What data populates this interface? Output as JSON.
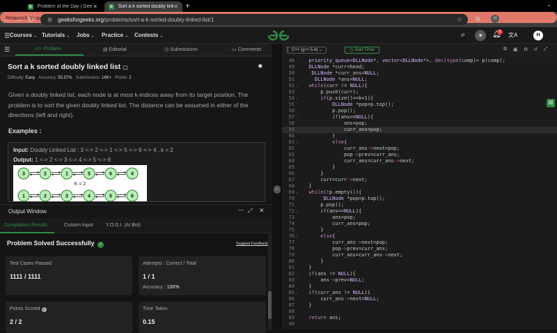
{
  "browser": {
    "tabs": [
      {
        "title": "Problem of the Day | GeeksforG",
        "active": false
      },
      {
        "title": "Sort a k sorted doubly linked",
        "active": true
      }
    ],
    "url_domain": "geeksforgeeks.org",
    "url_path": "/problems/sort-a-k-sorted-doubly-linked-list/1",
    "profile_initial": "H",
    "relaunch_label": "Relaunch to update"
  },
  "site": {
    "menu": [
      "Courses",
      "Tutorials",
      "Jobs",
      "Practice",
      "Contests"
    ],
    "notif_count": "5",
    "avatar": "H"
  },
  "problem_tabs": [
    "Problem",
    "Editorial",
    "Submissions",
    "Comments"
  ],
  "editor_bar": {
    "language": "C++ (g++ 5.4)",
    "timer": "Start Timer"
  },
  "problem": {
    "title": "Sort a k sorted doubly linked list",
    "difficulty_label": "Difficulty:",
    "difficulty": "Easy",
    "accuracy_label": "Accuracy:",
    "accuracy": "55.57%",
    "submissions_label": "Submissions:",
    "submissions": "16K+",
    "points_label": "Points:",
    "points": "2",
    "description": "Given a doubly linked list, each node is at most k-indices away from its target position. The problem is to sort the given doubly linked list. The distance can be assumed in either of the directions (left and right).",
    "examples_heading": "Examples :",
    "input_label": "Input:",
    "input_text": "Doubly Linked List : 3 <-> 2 <-> 1 <-> 5 <-> 6 <-> 4 , k = 2",
    "output_label": "Output:",
    "output_text": "1 <-> 2 <-> 3 <-> 4 <-> 5 <-> 6",
    "diagram_row1": [
      "3",
      "2",
      "1",
      "5",
      "6",
      "4"
    ],
    "diagram_k": "K = 2",
    "diagram_row2": [
      "1",
      "2",
      "3",
      "4",
      "5",
      "6"
    ]
  },
  "output": {
    "window_title": "Output Window",
    "tabs": [
      "Compilation Results",
      "Custom Input",
      "Y.O.G.I. (AI Bot)"
    ],
    "status": "Problem Solved Successfully",
    "suggest": "Suggest Feedback",
    "test_cases_label": "Test Cases Passed",
    "test_cases": "1111 / 1111",
    "attempts_label": "Attempts : Correct / Total",
    "attempts": "1 / 1",
    "accuracy_label": "Accuracy :",
    "accuracy": "100%",
    "points_label": "Points Scored",
    "points": "2 / 2",
    "time_label": "Time Taken",
    "time": "0.15"
  },
  "code": [
    {
      "n": "48",
      "t": "  priority_queue<DLLNode*, vector<DLLNode*>, decltype(comp)> p(comp);"
    },
    {
      "n": "49",
      "t": "  DLLNode *curr=head;"
    },
    {
      "n": "50",
      "t": "   DLLNode *curr_ans=NULL;"
    },
    {
      "n": "51",
      "t": "    DLLNode *ans=NULL;"
    },
    {
      "n": "52",
      "t": "  while(curr != NULL){",
      "f": true
    },
    {
      "n": "53",
      "t": "      p.push(curr);"
    },
    {
      "n": "54",
      "t": "      if(p.size()==k+1){",
      "f": true
    },
    {
      "n": "55",
      "t": "          DLLNode *pop=p.top();"
    },
    {
      "n": "56",
      "t": "          p.pop();"
    },
    {
      "n": "57",
      "t": "          if(ans==NULL){",
      "f": true
    },
    {
      "n": "58",
      "t": "              ans=pop;"
    },
    {
      "n": "59",
      "t": "              curr_ans=pop;",
      "hl": true
    },
    {
      "n": "60",
      "t": "          }"
    },
    {
      "n": "61",
      "t": "          else{",
      "f": true
    },
    {
      "n": "62",
      "t": "              curr_ans->next=pop;"
    },
    {
      "n": "63",
      "t": "              pop->prev=curr_ans;"
    },
    {
      "n": "64",
      "t": "              curr_ans=curr_ans->next;"
    },
    {
      "n": "65",
      "t": "          }"
    },
    {
      "n": "66",
      "t": "      }"
    },
    {
      "n": "67",
      "t": "      curr=curr->next;"
    },
    {
      "n": "68",
      "t": "  }"
    },
    {
      "n": "69",
      "t": "  while(!p.empty()){",
      "f": true
    },
    {
      "n": "70",
      "t": "       DLLNode *pop=p.top();"
    },
    {
      "n": "71",
      "t": "      p.pop();"
    },
    {
      "n": "72",
      "t": "      if(ans==NULL){",
      "f": true
    },
    {
      "n": "73",
      "t": "          ans=pop;"
    },
    {
      "n": "74",
      "t": "          curr_ans=pop;"
    },
    {
      "n": "75",
      "t": "      }"
    },
    {
      "n": "76",
      "t": "      else{",
      "f": true
    },
    {
      "n": "77",
      "t": "          curr_ans->next=pop;"
    },
    {
      "n": "78",
      "t": "          pop->prev=curr_ans;"
    },
    {
      "n": "79",
      "t": "          curr_ans=curr_ans->next;"
    },
    {
      "n": "80",
      "t": "      }"
    },
    {
      "n": "81",
      "t": "  }"
    },
    {
      "n": "82",
      "t": "  if(ans != NULL){",
      "f": true
    },
    {
      "n": "83",
      "t": "      ans->prev=NULL;"
    },
    {
      "n": "84",
      "t": "  }"
    },
    {
      "n": "85",
      "t": "  if(curr_ans != NULL){",
      "f": true
    },
    {
      "n": "86",
      "t": "      curr_ans->next=NULL;"
    },
    {
      "n": "87",
      "t": "  }"
    },
    {
      "n": "88",
      "t": ""
    },
    {
      "n": "89",
      "t": "  return ans;"
    },
    {
      "n": "90",
      "t": ""
    }
  ]
}
